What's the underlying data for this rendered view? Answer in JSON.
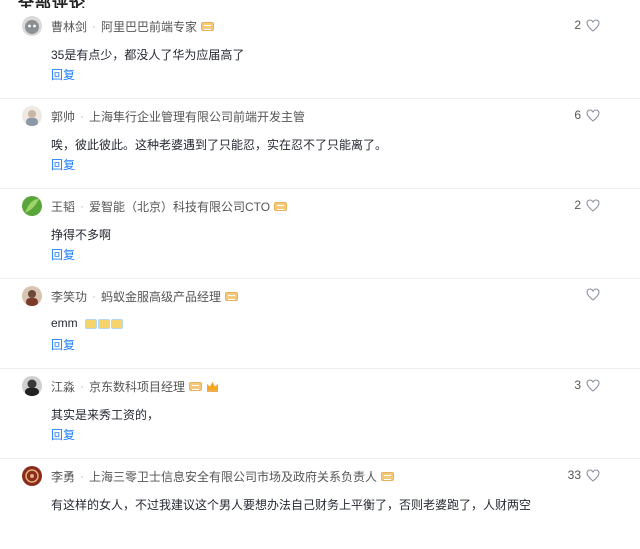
{
  "section": {
    "title": "全部评论"
  },
  "comments": [
    {
      "name": "曹林剑",
      "title": "阿里巴巴前端专家",
      "content": "35是有点少，都没人了华为应届高了",
      "likes": "2",
      "reply": "回复",
      "avatar_color": "#8a8f94"
    },
    {
      "name": "郭帅",
      "title": "上海隼行企业管理有限公司前端开发主管",
      "content": "唉，彼此彼此。这种老婆遇到了只能忍，实在忍不了只能离了。",
      "likes": "6",
      "reply": "回复",
      "avatar_color": "#c9b7a5"
    },
    {
      "name": "王韬",
      "title": "爱智能（北京）科技有限公司CTO",
      "content": "挣得不多啊",
      "likes": "2",
      "reply": "回复",
      "avatar_color": "#5aa53a"
    },
    {
      "name": "李笑功",
      "title": "蚂蚁金服高级产品经理",
      "content": "emm",
      "likes": "",
      "reply": "回复",
      "avatar_color": "#6b4a3a"
    },
    {
      "name": "江淼",
      "title": "京东数科项目经理",
      "content": "其实是来秀工资的，",
      "likes": "3",
      "reply": "回复",
      "avatar_color": "#3a3a3a"
    },
    {
      "name": "李勇",
      "title": "上海三零卫士信息安全有限公司市场及政府关系负责人",
      "content": "有这样的女人，不过我建议这个男人要想办法自己财务上平衡了，否则老婆跑了，人财两空",
      "likes": "33",
      "reply": "",
      "avatar_color": "#8b2b1e"
    }
  ],
  "colors": {
    "link": "#1e80ff",
    "badge": "#f4c97a",
    "crown": "#f5a623"
  }
}
